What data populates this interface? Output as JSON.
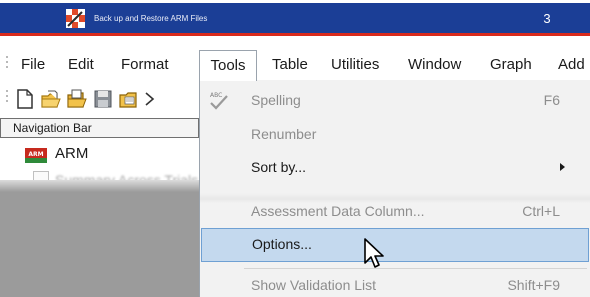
{
  "banner": {
    "title": "Back up and Restore ARM Files",
    "number": "3",
    "colors": {
      "blue": "#1b3e96",
      "red": "#d92a1c"
    }
  },
  "menubar": {
    "items": [
      "File",
      "Edit",
      "Format",
      "Tools",
      "Table",
      "Utilities",
      "Window",
      "Graph",
      "Add"
    ],
    "active": "Tools"
  },
  "toolbar": {
    "icons": [
      "new-document-icon",
      "open-folder-icon",
      "open-folder-alt-icon",
      "save-icon",
      "yellow-folder-icon",
      "overflow-chevron-icon"
    ]
  },
  "nav_panel": {
    "header": "Navigation Bar",
    "items": [
      {
        "label": "ARM",
        "icon": "arm-logo-icon"
      },
      {
        "label": "Summary Across Trials",
        "icon": "document-icon"
      }
    ]
  },
  "tools_menu": {
    "items": [
      {
        "label": "Spelling",
        "shortcut": "F6",
        "enabled": false,
        "icon": "spellcheck-icon"
      },
      {
        "label": "Renumber",
        "shortcut": "",
        "enabled": false
      },
      {
        "label": "Sort by...",
        "shortcut": "",
        "enabled": true,
        "submenu": true
      },
      {
        "label": "Assessment Data Column...",
        "shortcut": "Ctrl+L",
        "enabled": false
      },
      {
        "label": "Options...",
        "shortcut": "",
        "enabled": true,
        "highlighted": true
      },
      {
        "label": "Show Validation List",
        "shortcut": "Shift+F9",
        "enabled": false
      }
    ],
    "colors": {
      "highlight_fill": "#c4d9ee",
      "highlight_border": "#6fa0d3",
      "disabled_text": "#8d8d8d"
    }
  }
}
